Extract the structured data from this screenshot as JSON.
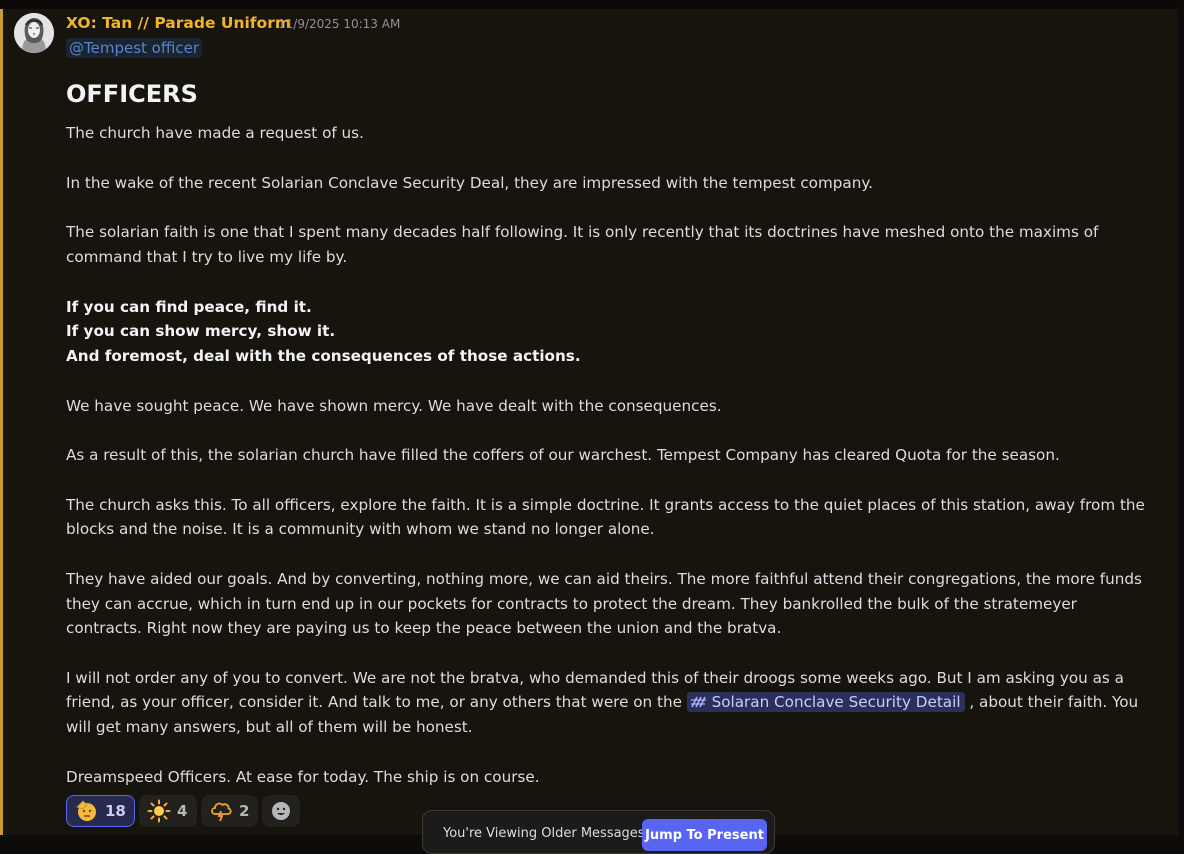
{
  "message": {
    "author": "XO: Tan // Parade Uniform",
    "timestamp": "11/9/2025 10:13 AM",
    "mention": "@Tempest officer",
    "heading": "OFFICERS",
    "lines": [
      "The church have made a request of us.",
      "In the wake of the recent Solarian  Conclave Security Deal, they are impressed with the tempest company.",
      "The solarian faith is one that I spent many decades half following. It is only recently that its doctrines have meshed onto the maxims of",
      "command that I try to live my life by.",
      "If you can find peace, find it.",
      "If you can show mercy, show it.",
      "And foremost, deal with the consequences of those actions.",
      "We have sought peace. We have shown mercy. We have dealt with the consequences.",
      "As a result of this, the solarian church have filled the coffers of our warchest. Tempest Company has cleared Quota for the season.",
      "The church asks this. To all officers, explore the faith. It is a simple doctrine. It grants access to the quiet places of this station, away from the",
      "blocks and the noise. It is a community with whom we stand no longer alone.",
      "They have aided our goals. And by converting, nothing more, we can aid theirs. The more faithful attend their congregations, the more funds",
      "they can accrue, which in turn end up in our pockets for contracts to protect the dream. They bankrolled the bulk of the stratemeyer",
      "contracts. Right now they are paying us to keep the peace between the union and the bratva.",
      "I will not order any of you to convert. We are not the bratva, who demanded this of their droogs some weeks ago. But I am asking you as a",
      "friend, as your officer, consider it. And talk to me, or any others that were on the",
      ", about their faith. You",
      "will get many answers, but all of them will be honest.",
      "Dreamspeed Officers. At ease for today. The ship is on course."
    ],
    "channel_link": "Solaran Conclave Security Detail",
    "channel_icon": "thread-channel-icon"
  },
  "reactions": [
    {
      "emoji": "saluting-face",
      "count": "18",
      "active": true
    },
    {
      "emoji": "sun",
      "count": "4",
      "active": false
    },
    {
      "emoji": "cloud-lightning",
      "count": "2",
      "active": false
    },
    {
      "emoji": "add-reaction",
      "count": "",
      "active": false
    }
  ],
  "older_messages_bar": {
    "text": "You're Viewing Older Messages",
    "button": "Jump To Present"
  },
  "colors": {
    "author": "#efb52c",
    "accent_border": "#c99b39",
    "mention": "#5a83c9",
    "button": "#5865f2"
  }
}
